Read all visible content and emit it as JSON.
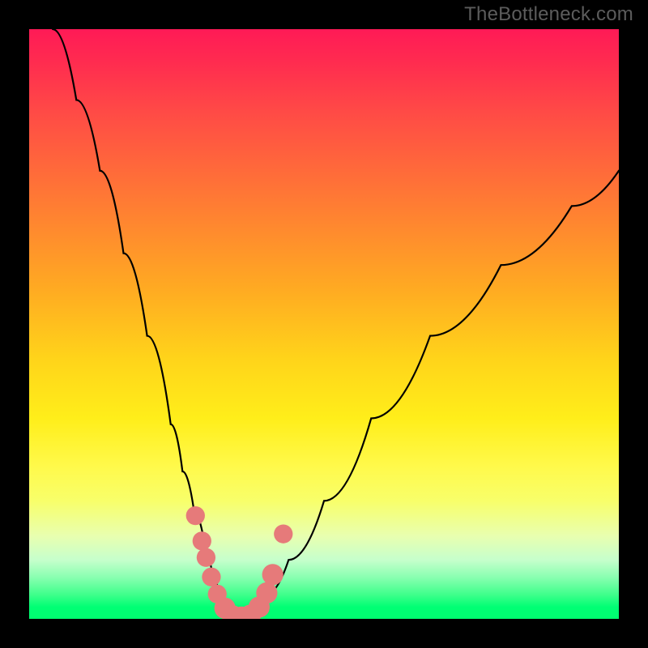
{
  "watermark": "TheBottleneck.com",
  "chart_data": {
    "type": "line",
    "title": "",
    "xlabel": "",
    "ylabel": "",
    "xlim": [
      0,
      100
    ],
    "ylim": [
      0,
      100
    ],
    "gradient_stops": [
      {
        "pos": 0,
        "color": "#ff1a56"
      },
      {
        "pos": 0.5,
        "color": "#ffd41a"
      },
      {
        "pos": 0.8,
        "color": "#f8ff6a"
      },
      {
        "pos": 1.0,
        "color": "#00ff70"
      }
    ],
    "series": [
      {
        "name": "left-branch",
        "x": [
          4,
          8,
          12,
          16,
          20,
          24,
          26,
          28,
          30,
          31,
          32,
          33,
          34,
          35
        ],
        "y": [
          100,
          88,
          76,
          62,
          48,
          33,
          25,
          18,
          11,
          8,
          5,
          3,
          1.2,
          0.4
        ]
      },
      {
        "name": "right-branch",
        "x": [
          35,
          36,
          38,
          40,
          44,
          50,
          58,
          68,
          80,
          92,
          100
        ],
        "y": [
          0.4,
          0.6,
          1.8,
          4,
          10,
          20,
          34,
          48,
          60,
          70,
          76
        ]
      }
    ],
    "markers": {
      "name": "near-minimum-points",
      "color": "#e67a7a",
      "points": [
        {
          "x": 28.2,
          "y": 17.5,
          "r": 1.6
        },
        {
          "x": 29.3,
          "y": 13.2,
          "r": 1.6
        },
        {
          "x": 30.0,
          "y": 10.4,
          "r": 1.6
        },
        {
          "x": 30.9,
          "y": 7.1,
          "r": 1.6
        },
        {
          "x": 31.9,
          "y": 4.2,
          "r": 1.6
        },
        {
          "x": 33.2,
          "y": 1.8,
          "r": 1.8
        },
        {
          "x": 34.5,
          "y": 0.5,
          "r": 1.8
        },
        {
          "x": 36.0,
          "y": 0.3,
          "r": 1.8
        },
        {
          "x": 37.5,
          "y": 0.6,
          "r": 1.8
        },
        {
          "x": 39.0,
          "y": 2.0,
          "r": 1.8
        },
        {
          "x": 40.3,
          "y": 4.4,
          "r": 1.8
        },
        {
          "x": 41.3,
          "y": 7.5,
          "r": 1.8
        },
        {
          "x": 43.1,
          "y": 14.4,
          "r": 1.6
        }
      ]
    }
  }
}
